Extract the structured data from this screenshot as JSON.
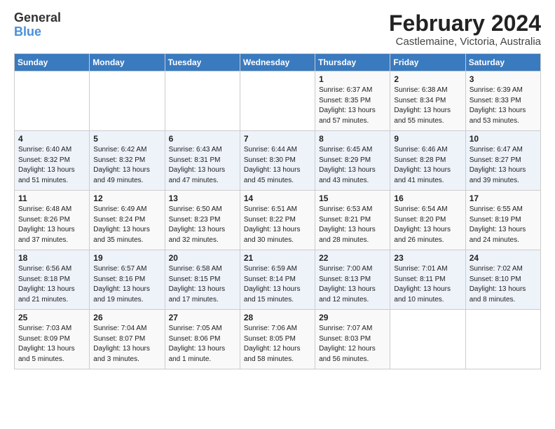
{
  "header": {
    "logo_line1": "General",
    "logo_line2": "Blue",
    "title": "February 2024",
    "subtitle": "Castlemaine, Victoria, Australia"
  },
  "weekdays": [
    "Sunday",
    "Monday",
    "Tuesday",
    "Wednesday",
    "Thursday",
    "Friday",
    "Saturday"
  ],
  "weeks": [
    [
      {
        "day": "",
        "text": ""
      },
      {
        "day": "",
        "text": ""
      },
      {
        "day": "",
        "text": ""
      },
      {
        "day": "",
        "text": ""
      },
      {
        "day": "1",
        "text": "Sunrise: 6:37 AM\nSunset: 8:35 PM\nDaylight: 13 hours\nand 57 minutes."
      },
      {
        "day": "2",
        "text": "Sunrise: 6:38 AM\nSunset: 8:34 PM\nDaylight: 13 hours\nand 55 minutes."
      },
      {
        "day": "3",
        "text": "Sunrise: 6:39 AM\nSunset: 8:33 PM\nDaylight: 13 hours\nand 53 minutes."
      }
    ],
    [
      {
        "day": "4",
        "text": "Sunrise: 6:40 AM\nSunset: 8:32 PM\nDaylight: 13 hours\nand 51 minutes."
      },
      {
        "day": "5",
        "text": "Sunrise: 6:42 AM\nSunset: 8:32 PM\nDaylight: 13 hours\nand 49 minutes."
      },
      {
        "day": "6",
        "text": "Sunrise: 6:43 AM\nSunset: 8:31 PM\nDaylight: 13 hours\nand 47 minutes."
      },
      {
        "day": "7",
        "text": "Sunrise: 6:44 AM\nSunset: 8:30 PM\nDaylight: 13 hours\nand 45 minutes."
      },
      {
        "day": "8",
        "text": "Sunrise: 6:45 AM\nSunset: 8:29 PM\nDaylight: 13 hours\nand 43 minutes."
      },
      {
        "day": "9",
        "text": "Sunrise: 6:46 AM\nSunset: 8:28 PM\nDaylight: 13 hours\nand 41 minutes."
      },
      {
        "day": "10",
        "text": "Sunrise: 6:47 AM\nSunset: 8:27 PM\nDaylight: 13 hours\nand 39 minutes."
      }
    ],
    [
      {
        "day": "11",
        "text": "Sunrise: 6:48 AM\nSunset: 8:26 PM\nDaylight: 13 hours\nand 37 minutes."
      },
      {
        "day": "12",
        "text": "Sunrise: 6:49 AM\nSunset: 8:24 PM\nDaylight: 13 hours\nand 35 minutes."
      },
      {
        "day": "13",
        "text": "Sunrise: 6:50 AM\nSunset: 8:23 PM\nDaylight: 13 hours\nand 32 minutes."
      },
      {
        "day": "14",
        "text": "Sunrise: 6:51 AM\nSunset: 8:22 PM\nDaylight: 13 hours\nand 30 minutes."
      },
      {
        "day": "15",
        "text": "Sunrise: 6:53 AM\nSunset: 8:21 PM\nDaylight: 13 hours\nand 28 minutes."
      },
      {
        "day": "16",
        "text": "Sunrise: 6:54 AM\nSunset: 8:20 PM\nDaylight: 13 hours\nand 26 minutes."
      },
      {
        "day": "17",
        "text": "Sunrise: 6:55 AM\nSunset: 8:19 PM\nDaylight: 13 hours\nand 24 minutes."
      }
    ],
    [
      {
        "day": "18",
        "text": "Sunrise: 6:56 AM\nSunset: 8:18 PM\nDaylight: 13 hours\nand 21 minutes."
      },
      {
        "day": "19",
        "text": "Sunrise: 6:57 AM\nSunset: 8:16 PM\nDaylight: 13 hours\nand 19 minutes."
      },
      {
        "day": "20",
        "text": "Sunrise: 6:58 AM\nSunset: 8:15 PM\nDaylight: 13 hours\nand 17 minutes."
      },
      {
        "day": "21",
        "text": "Sunrise: 6:59 AM\nSunset: 8:14 PM\nDaylight: 13 hours\nand 15 minutes."
      },
      {
        "day": "22",
        "text": "Sunrise: 7:00 AM\nSunset: 8:13 PM\nDaylight: 13 hours\nand 12 minutes."
      },
      {
        "day": "23",
        "text": "Sunrise: 7:01 AM\nSunset: 8:11 PM\nDaylight: 13 hours\nand 10 minutes."
      },
      {
        "day": "24",
        "text": "Sunrise: 7:02 AM\nSunset: 8:10 PM\nDaylight: 13 hours\nand 8 minutes."
      }
    ],
    [
      {
        "day": "25",
        "text": "Sunrise: 7:03 AM\nSunset: 8:09 PM\nDaylight: 13 hours\nand 5 minutes."
      },
      {
        "day": "26",
        "text": "Sunrise: 7:04 AM\nSunset: 8:07 PM\nDaylight: 13 hours\nand 3 minutes."
      },
      {
        "day": "27",
        "text": "Sunrise: 7:05 AM\nSunset: 8:06 PM\nDaylight: 13 hours\nand 1 minute."
      },
      {
        "day": "28",
        "text": "Sunrise: 7:06 AM\nSunset: 8:05 PM\nDaylight: 12 hours\nand 58 minutes."
      },
      {
        "day": "29",
        "text": "Sunrise: 7:07 AM\nSunset: 8:03 PM\nDaylight: 12 hours\nand 56 minutes."
      },
      {
        "day": "",
        "text": ""
      },
      {
        "day": "",
        "text": ""
      }
    ]
  ]
}
